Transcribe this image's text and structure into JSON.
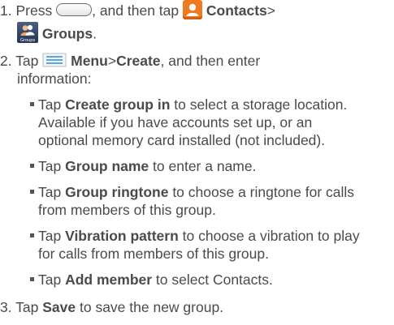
{
  "step1": {
    "number": "1.",
    "press": "Press",
    "then_tap": ", and then tap",
    "contacts_label": "Contacts",
    "separator": ">",
    "groups_label": "Groups",
    "period": ".",
    "groups_icon_caption": "Groups",
    "home_key_icon": "home-key-icon",
    "contacts_icon": "contacts-icon",
    "groups_icon": "groups-icon"
  },
  "step2": {
    "number": "2.",
    "tap": "Tap",
    "menu_label": "Menu",
    "separator": ">",
    "create_label": "Create",
    "rest_line1": ", and then enter",
    "rest_line2": "information:",
    "menu_icon": "menu-key-icon"
  },
  "bullets": [
    {
      "tap": "Tap",
      "bold": "Create group in",
      "line1": " to select a storage location.",
      "line2": "Available if you have accounts set up, or an",
      "line3": "optional memory card installed (not included)."
    },
    {
      "tap": "Tap",
      "bold": "Group name",
      "line1": " to enter a name."
    },
    {
      "tap": "Tap",
      "bold": "Group ringtone",
      "line1": " to choose a ringtone for calls",
      "line2": "from members of this group."
    },
    {
      "tap": "Tap",
      "bold": "Vibration pattern",
      "line1": " to choose a vibration to play",
      "line2": "for calls from members of this group."
    },
    {
      "tap": "Tap",
      "bold": "Add member",
      "line1": " to select Contacts."
    }
  ],
  "step3": {
    "number": "3.",
    "tap": "Tap",
    "save_label": "Save",
    "rest": " to save the new group."
  },
  "colors": {
    "text": "#4a4a4a",
    "contacts_icon_bg": "#ef7a1f",
    "groups_icon_bg": "#2f4168"
  }
}
